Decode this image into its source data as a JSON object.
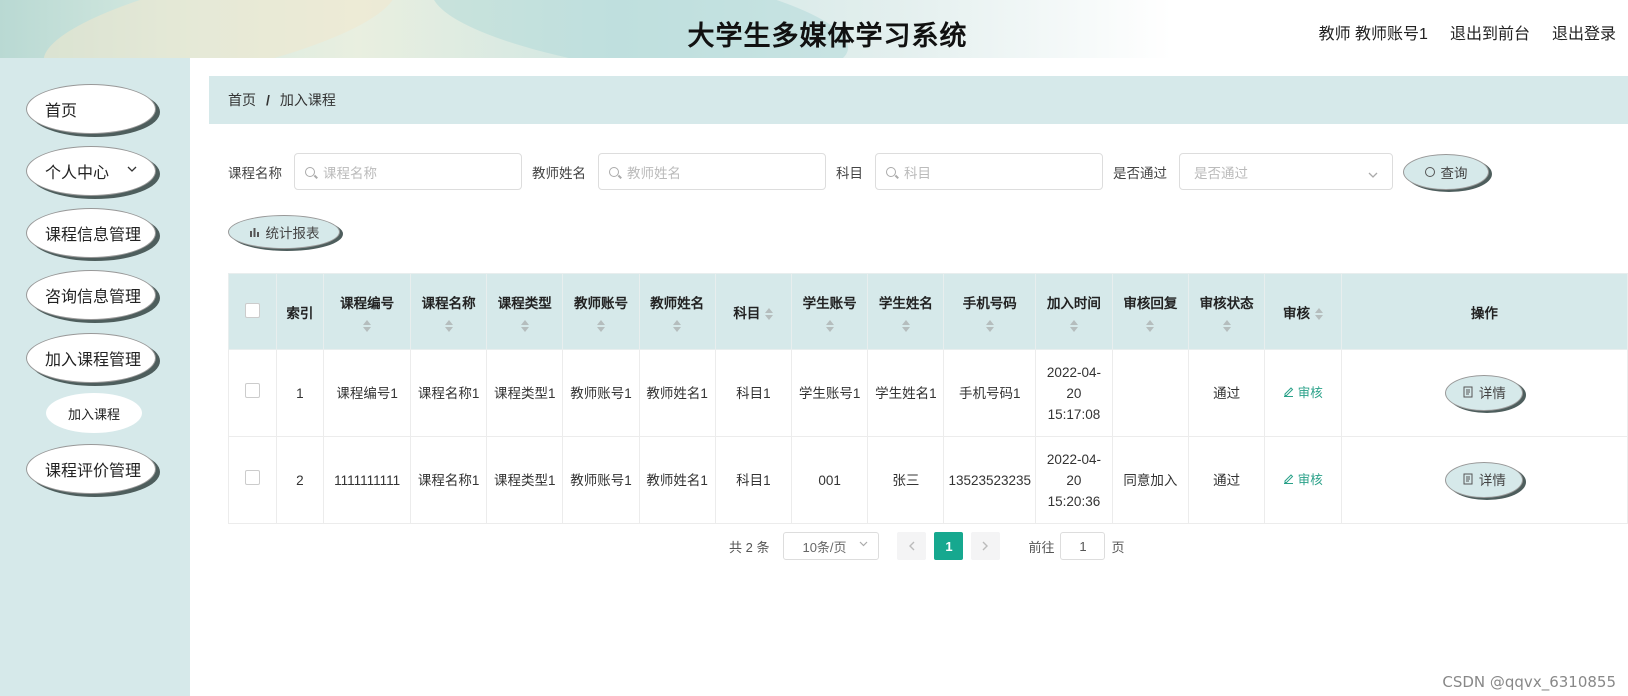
{
  "header": {
    "title": "大学生多媒体学习系统",
    "user": "教师 教师账号1",
    "to_front": "退出到前台",
    "logout": "退出登录"
  },
  "sidebar": {
    "items": [
      {
        "label": "首页"
      },
      {
        "label": "个人中心",
        "expand_icon": "chevron-down"
      },
      {
        "label": "课程信息管理"
      },
      {
        "label": "咨询信息管理"
      },
      {
        "label": "加入课程管理"
      },
      {
        "label": "课程评价管理"
      }
    ],
    "submenu": {
      "label": "加入课程"
    }
  },
  "breadcrumb": {
    "home": "首页",
    "separator": "/",
    "current": "加入课程"
  },
  "search": {
    "course_name_label": "课程名称",
    "course_name_placeholder": "课程名称",
    "teacher_name_label": "教师姓名",
    "teacher_name_placeholder": "教师姓名",
    "subject_label": "科目",
    "subject_placeholder": "科目",
    "passed_label": "是否通过",
    "passed_placeholder": "是否通过",
    "query_button": "查询"
  },
  "report_button": "统计报表",
  "table": {
    "columns": [
      "索引",
      "课程编号",
      "课程名称",
      "课程类型",
      "教师账号",
      "教师姓名",
      "科目",
      "学生账号",
      "学生姓名",
      "手机号码",
      "加入时间",
      "审核回复",
      "审核状态",
      "审核",
      "操作"
    ],
    "rows": [
      {
        "index": "1",
        "course_no": "课程编号1",
        "course_name": "课程名称1",
        "course_type": "课程类型1",
        "teacher_account": "教师账号1",
        "teacher_name": "教师姓名1",
        "subject": "科目1",
        "student_account": "学生账号1",
        "student_name": "学生姓名1",
        "phone": "手机号码1",
        "join_time": "2022-04-20 15:17:08",
        "reply": "",
        "status": "通过",
        "audit": "审核",
        "action": "详情"
      },
      {
        "index": "2",
        "course_no": "1111111111",
        "course_name": "课程名称1",
        "course_type": "课程类型1",
        "teacher_account": "教师账号1",
        "teacher_name": "教师姓名1",
        "subject": "科目1",
        "student_account": "001",
        "student_name": "张三",
        "phone": "13523523235",
        "join_time": "2022-04-20 15:20:36",
        "reply": "同意加入",
        "status": "通过",
        "audit": "审核",
        "action": "详情"
      }
    ]
  },
  "pagination": {
    "total": "共 2 条",
    "page_size": "10条/页",
    "current_page": "1",
    "goto_label": "前往",
    "goto_value": "1",
    "page_unit": "页"
  },
  "watermark": "CSDN @qqvx_6310855",
  "colors": {
    "accent": "#16a88f",
    "panel": "#d6e9ea",
    "pill_shadow": "#4e5e5d"
  }
}
